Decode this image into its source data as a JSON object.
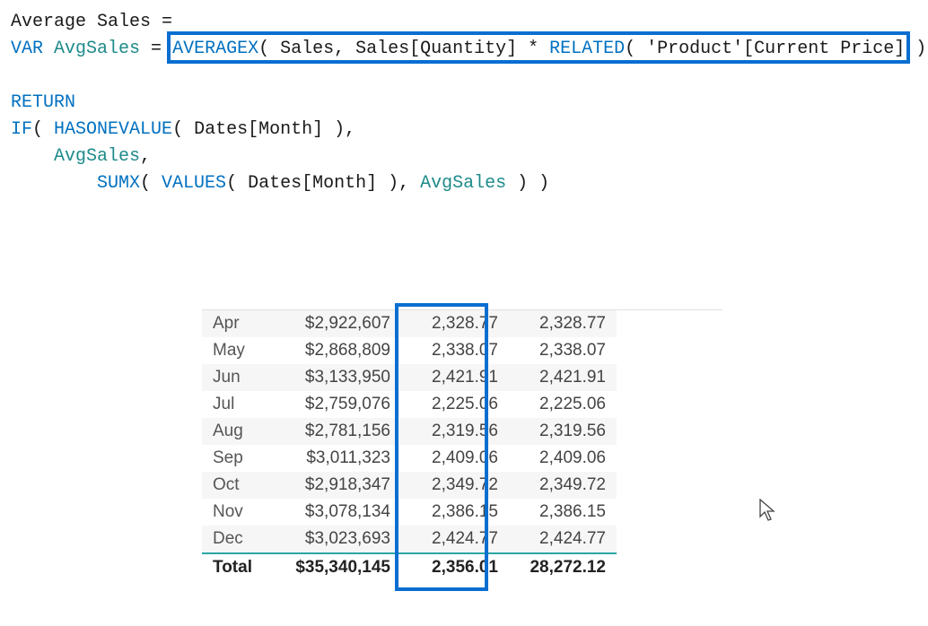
{
  "dax": {
    "line1_measure": "Average Sales",
    "line1_eq": " = ",
    "line2_var": "VAR",
    "line2_name": " AvgSales",
    "line2_eq": " = ",
    "line2_fn1": "AVERAGEX",
    "line2_p1": "( Sales, Sales[Quantity] * ",
    "line2_fn2": "RELATED",
    "line2_p2": "( 'Product'[Current Price] ) )",
    "line3_blank": "",
    "line4_return": "RETURN",
    "line5_if": "IF",
    "line5_p1": "( ",
    "line5_fn": "HASONEVALUE",
    "line5_p2": "( Dates[Month] ),",
    "line6_var": "    AvgSales",
    "line6_comma": ",",
    "line7_indent": "        ",
    "line7_fn1": "SUMX",
    "line7_p1": "( ",
    "line7_fn2": "VALUES",
    "line7_p2": "( Dates[Month] ), ",
    "line7_var": "AvgSales",
    "line7_p3": " ) )"
  },
  "rows": {
    "r0": {
      "month": "Apr",
      "sales": "$2,922,607",
      "avg1": "2,328.77",
      "avg2": "2,328.77"
    },
    "r1": {
      "month": "May",
      "sales": "$2,868,809",
      "avg1": "2,338.07",
      "avg2": "2,338.07"
    },
    "r2": {
      "month": "Jun",
      "sales": "$3,133,950",
      "avg1": "2,421.91",
      "avg2": "2,421.91"
    },
    "r3": {
      "month": "Jul",
      "sales": "$2,759,076",
      "avg1": "2,225.06",
      "avg2": "2,225.06"
    },
    "r4": {
      "month": "Aug",
      "sales": "$2,781,156",
      "avg1": "2,319.56",
      "avg2": "2,319.56"
    },
    "r5": {
      "month": "Sep",
      "sales": "$3,011,323",
      "avg1": "2,409.06",
      "avg2": "2,409.06"
    },
    "r6": {
      "month": "Oct",
      "sales": "$2,918,347",
      "avg1": "2,349.72",
      "avg2": "2,349.72"
    },
    "r7": {
      "month": "Nov",
      "sales": "$3,078,134",
      "avg1": "2,386.15",
      "avg2": "2,386.15"
    },
    "r8": {
      "month": "Dec",
      "sales": "$3,023,693",
      "avg1": "2,424.77",
      "avg2": "2,424.77"
    }
  },
  "total": {
    "label": "Total",
    "sales": "$35,340,145",
    "avg1": "2,356.01",
    "avg2": "28,272.12"
  }
}
